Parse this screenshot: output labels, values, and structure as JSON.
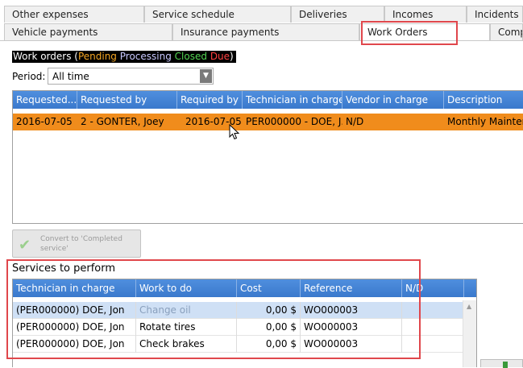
{
  "tabs_row1": [
    {
      "label": "Other expenses"
    },
    {
      "label": "Service schedule"
    },
    {
      "label": "Deliveries"
    },
    {
      "label": "Incomes"
    },
    {
      "label": "Incidents"
    }
  ],
  "tabs_row2": [
    {
      "label": "Vehicle payments"
    },
    {
      "label": "Insurance payments"
    },
    {
      "label": "Work Orders",
      "active": true
    },
    {
      "label": "Comp"
    }
  ],
  "legend": {
    "prefix": "Work orders (",
    "pending": "Pending",
    "processing": "Processing",
    "closed": "Closed",
    "due": "Due",
    "suffix": ")"
  },
  "period": {
    "label": "Period:",
    "value": "All time"
  },
  "work_orders": {
    "columns": [
      "Requested...",
      "Requested by",
      "Required by",
      "Technician in charge",
      "Vendor in charge",
      "Description"
    ],
    "rows": [
      {
        "requested": "2016-07-05",
        "requested_by": "2 - GONTER, Joey",
        "required_by": "2016-07-05",
        "technician": "PER000000 - DOE, J...",
        "vendor": "N/D",
        "description": "Monthly Maintena",
        "status": "pending"
      }
    ]
  },
  "convert_button": {
    "label": "Convert to 'Completed service'"
  },
  "services": {
    "title": "Services to perform",
    "columns": [
      "Technician in charge",
      "Work to do",
      "Cost",
      "Reference",
      "N/D"
    ],
    "rows": [
      {
        "technician": "(PER000000) DOE, Jon",
        "work": "Change oil",
        "cost": "0,00 $",
        "reference": "WO000003"
      },
      {
        "technician": "(PER000000) DOE, Jon",
        "work": "Rotate tires",
        "cost": "0,00 $",
        "reference": "WO000003"
      },
      {
        "technician": "(PER000000) DOE, Jon",
        "work": "Check brakes",
        "cost": "0,00 $",
        "reference": "WO000003"
      }
    ]
  },
  "colors": {
    "header_blue": "#3a79cc",
    "pending_row": "#f08c1c",
    "highlight_red": "#e0474c"
  }
}
